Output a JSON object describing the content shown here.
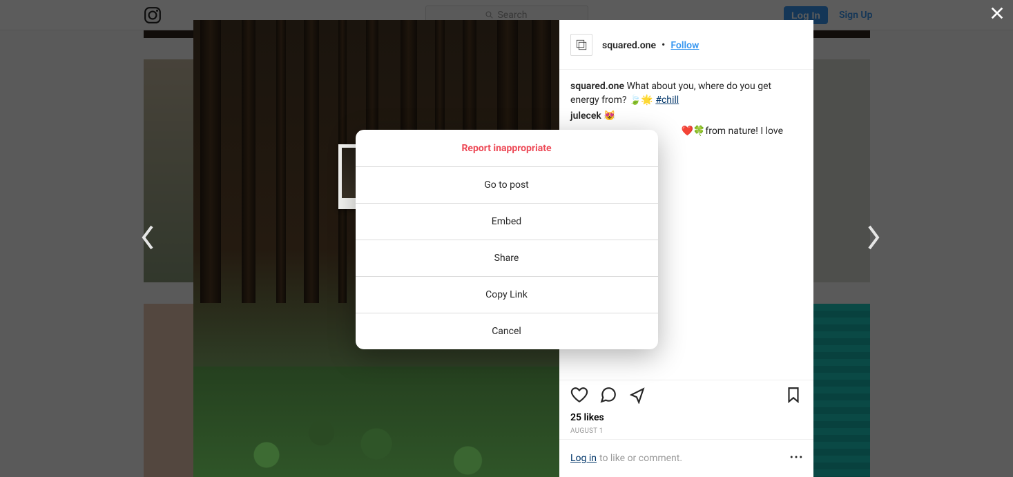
{
  "nav": {
    "search_placeholder": "Search",
    "login_label": "Log In",
    "signup_label": "Sign Up"
  },
  "post": {
    "author": "squared.one",
    "separator": "•",
    "follow_label": "Follow",
    "caption_author": "squared.one",
    "caption_text": "What about you, where do you get energy from? 🍃🌟 ",
    "caption_hashtag": "#chill",
    "comment1_author": "julecek",
    "comment1_text": " 😻",
    "comment2_fragment": "from nature! I love",
    "likes_text": "25 likes",
    "date_text": "August 1",
    "cta_login": "Log in",
    "cta_rest": "to like or comment."
  },
  "dialog": {
    "items": [
      "Report inappropriate",
      "Go to post",
      "Embed",
      "Share",
      "Copy Link",
      "Cancel"
    ]
  }
}
